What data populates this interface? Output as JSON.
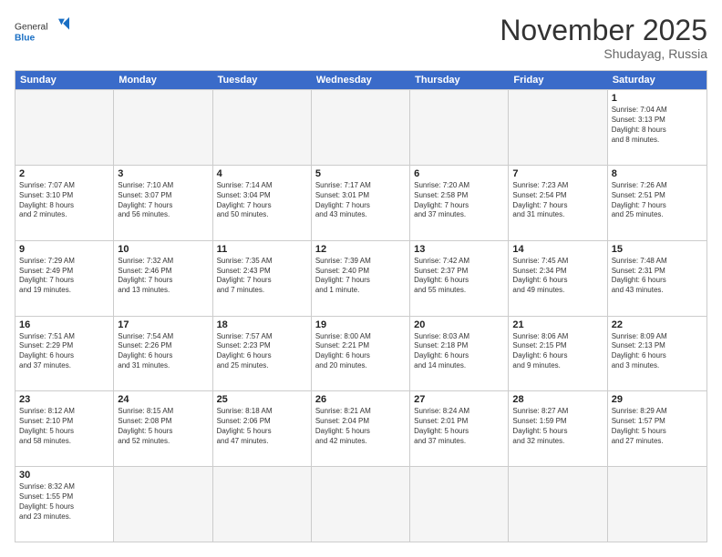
{
  "logo": {
    "general": "General",
    "blue": "Blue"
  },
  "title": "November 2025",
  "location": "Shudayag, Russia",
  "header_days": [
    "Sunday",
    "Monday",
    "Tuesday",
    "Wednesday",
    "Thursday",
    "Friday",
    "Saturday"
  ],
  "rows": [
    [
      {
        "day": "",
        "info": "",
        "empty": true
      },
      {
        "day": "",
        "info": "",
        "empty": true
      },
      {
        "day": "",
        "info": "",
        "empty": true
      },
      {
        "day": "",
        "info": "",
        "empty": true
      },
      {
        "day": "",
        "info": "",
        "empty": true
      },
      {
        "day": "",
        "info": "",
        "empty": true
      },
      {
        "day": "1",
        "info": "Sunrise: 7:04 AM\nSunset: 3:13 PM\nDaylight: 8 hours\nand 8 minutes."
      }
    ],
    [
      {
        "day": "2",
        "info": "Sunrise: 7:07 AM\nSunset: 3:10 PM\nDaylight: 8 hours\nand 2 minutes."
      },
      {
        "day": "3",
        "info": "Sunrise: 7:10 AM\nSunset: 3:07 PM\nDaylight: 7 hours\nand 56 minutes."
      },
      {
        "day": "4",
        "info": "Sunrise: 7:14 AM\nSunset: 3:04 PM\nDaylight: 7 hours\nand 50 minutes."
      },
      {
        "day": "5",
        "info": "Sunrise: 7:17 AM\nSunset: 3:01 PM\nDaylight: 7 hours\nand 43 minutes."
      },
      {
        "day": "6",
        "info": "Sunrise: 7:20 AM\nSunset: 2:58 PM\nDaylight: 7 hours\nand 37 minutes."
      },
      {
        "day": "7",
        "info": "Sunrise: 7:23 AM\nSunset: 2:54 PM\nDaylight: 7 hours\nand 31 minutes."
      },
      {
        "day": "8",
        "info": "Sunrise: 7:26 AM\nSunset: 2:51 PM\nDaylight: 7 hours\nand 25 minutes."
      }
    ],
    [
      {
        "day": "9",
        "info": "Sunrise: 7:29 AM\nSunset: 2:49 PM\nDaylight: 7 hours\nand 19 minutes."
      },
      {
        "day": "10",
        "info": "Sunrise: 7:32 AM\nSunset: 2:46 PM\nDaylight: 7 hours\nand 13 minutes."
      },
      {
        "day": "11",
        "info": "Sunrise: 7:35 AM\nSunset: 2:43 PM\nDaylight: 7 hours\nand 7 minutes."
      },
      {
        "day": "12",
        "info": "Sunrise: 7:39 AM\nSunset: 2:40 PM\nDaylight: 7 hours\nand 1 minute."
      },
      {
        "day": "13",
        "info": "Sunrise: 7:42 AM\nSunset: 2:37 PM\nDaylight: 6 hours\nand 55 minutes."
      },
      {
        "day": "14",
        "info": "Sunrise: 7:45 AM\nSunset: 2:34 PM\nDaylight: 6 hours\nand 49 minutes."
      },
      {
        "day": "15",
        "info": "Sunrise: 7:48 AM\nSunset: 2:31 PM\nDaylight: 6 hours\nand 43 minutes."
      }
    ],
    [
      {
        "day": "16",
        "info": "Sunrise: 7:51 AM\nSunset: 2:29 PM\nDaylight: 6 hours\nand 37 minutes."
      },
      {
        "day": "17",
        "info": "Sunrise: 7:54 AM\nSunset: 2:26 PM\nDaylight: 6 hours\nand 31 minutes."
      },
      {
        "day": "18",
        "info": "Sunrise: 7:57 AM\nSunset: 2:23 PM\nDaylight: 6 hours\nand 25 minutes."
      },
      {
        "day": "19",
        "info": "Sunrise: 8:00 AM\nSunset: 2:21 PM\nDaylight: 6 hours\nand 20 minutes."
      },
      {
        "day": "20",
        "info": "Sunrise: 8:03 AM\nSunset: 2:18 PM\nDaylight: 6 hours\nand 14 minutes."
      },
      {
        "day": "21",
        "info": "Sunrise: 8:06 AM\nSunset: 2:15 PM\nDaylight: 6 hours\nand 9 minutes."
      },
      {
        "day": "22",
        "info": "Sunrise: 8:09 AM\nSunset: 2:13 PM\nDaylight: 6 hours\nand 3 minutes."
      }
    ],
    [
      {
        "day": "23",
        "info": "Sunrise: 8:12 AM\nSunset: 2:10 PM\nDaylight: 5 hours\nand 58 minutes."
      },
      {
        "day": "24",
        "info": "Sunrise: 8:15 AM\nSunset: 2:08 PM\nDaylight: 5 hours\nand 52 minutes."
      },
      {
        "day": "25",
        "info": "Sunrise: 8:18 AM\nSunset: 2:06 PM\nDaylight: 5 hours\nand 47 minutes."
      },
      {
        "day": "26",
        "info": "Sunrise: 8:21 AM\nSunset: 2:04 PM\nDaylight: 5 hours\nand 42 minutes."
      },
      {
        "day": "27",
        "info": "Sunrise: 8:24 AM\nSunset: 2:01 PM\nDaylight: 5 hours\nand 37 minutes."
      },
      {
        "day": "28",
        "info": "Sunrise: 8:27 AM\nSunset: 1:59 PM\nDaylight: 5 hours\nand 32 minutes."
      },
      {
        "day": "29",
        "info": "Sunrise: 8:29 AM\nSunset: 1:57 PM\nDaylight: 5 hours\nand 27 minutes."
      }
    ],
    [
      {
        "day": "30",
        "info": "Sunrise: 8:32 AM\nSunset: 1:55 PM\nDaylight: 5 hours\nand 23 minutes."
      },
      {
        "day": "",
        "info": "",
        "empty": true
      },
      {
        "day": "",
        "info": "",
        "empty": true
      },
      {
        "day": "",
        "info": "",
        "empty": true
      },
      {
        "day": "",
        "info": "",
        "empty": true
      },
      {
        "day": "",
        "info": "",
        "empty": true
      },
      {
        "day": "",
        "info": "",
        "empty": true
      }
    ]
  ]
}
